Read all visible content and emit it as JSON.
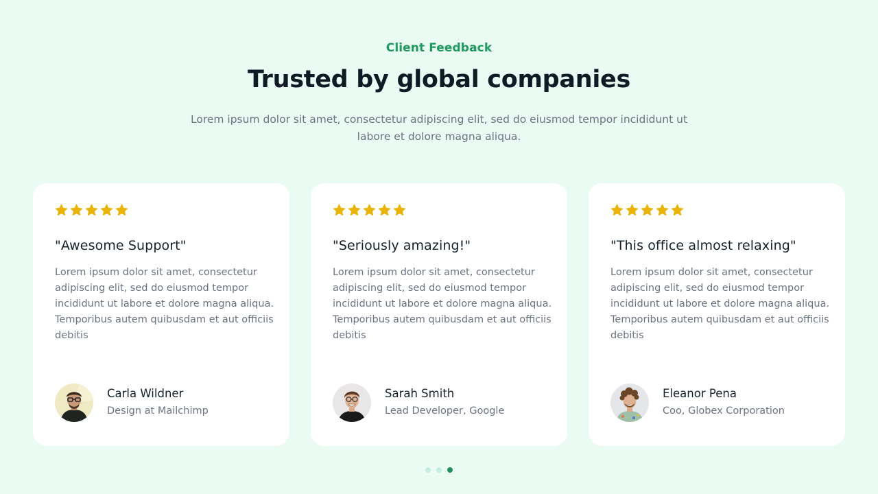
{
  "section": {
    "eyebrow": "Client Feedback",
    "title": "Trusted by global companies",
    "subtitle": "Lorem ipsum dolor sit amet, consectetur adipiscing elit, sed do eiusmod tempor incididunt ut labore et dolore magna aliqua."
  },
  "colors": {
    "accent": "#1f9a5e",
    "star": "#eab308",
    "background": "#eafbf3",
    "dot_active": "#1f8f5c",
    "dot_inactive": "#c5ece0"
  },
  "testimonials": [
    {
      "rating": 5,
      "quote": "\"Awesome Support\"",
      "text": "Lorem ipsum dolor sit amet, consectetur adipiscing elit, sed do eiusmod tempor incididunt ut labore et dolore magna aliqua. Temporibus autem quibusdam et aut officiis debitis",
      "name": "Carla Wildner",
      "role": "Design at Mailchimp",
      "avatar_icon": "avatar-man-glasses"
    },
    {
      "rating": 5,
      "quote": "\"Seriously amazing!\"",
      "text": "Lorem ipsum dolor sit amet, consectetur adipiscing elit, sed do eiusmod tempor incididunt ut labore et dolore magna aliqua. Temporibus autem quibusdam et aut officiis debitis",
      "name": "Sarah Smith",
      "role": "Lead Developer, Google",
      "avatar_icon": "avatar-man-smiling"
    },
    {
      "rating": 5,
      "quote": "\"This office almost relaxing\"",
      "text": "Lorem ipsum dolor sit amet, consectetur adipiscing elit, sed do eiusmod tempor incididunt ut labore et dolore magna aliqua. Temporibus autem quibusdam et aut officiis debitis",
      "name": "Eleanor Pena",
      "role": "Coo, Globex Corporation",
      "avatar_icon": "avatar-man-curly-hair"
    }
  ],
  "pagination": {
    "count": 3,
    "active_index": 2
  }
}
